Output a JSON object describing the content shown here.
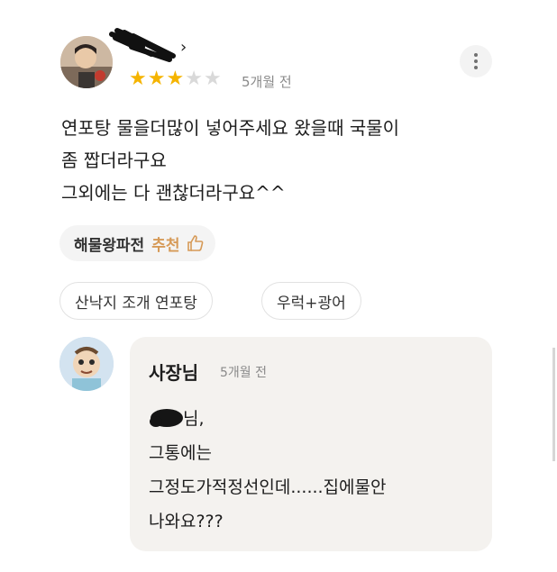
{
  "review": {
    "time_ago": "5개월 전",
    "rating": 3,
    "max_rating": 5,
    "text_lines": [
      "연포탕 물을더많이 넣어주세요 왔을때 국물이",
      "좀 짭더라구요",
      "그외에는 다 괜찮더라구요^^"
    ],
    "chevron": "›",
    "menu": {
      "name": "해물왕파전",
      "recommend_label": "추천"
    },
    "tags": [
      "산낙지 조개 연포탕",
      "우럭+광어"
    ]
  },
  "owner_reply": {
    "name": "사장님",
    "time_ago": "5개월 전",
    "greeting_suffix": "님,",
    "lines": [
      "그통에는",
      "그정도가적정선인데......집에물안",
      "나와요???"
    ]
  },
  "colors": {
    "star": "#f5b400",
    "star_off": "#d9d9d9",
    "recommend": "#d69a57",
    "bubble": "#f4f2ef"
  },
  "icons": [
    "more-vertical-icon",
    "thumbs-up-icon",
    "chevron-right-icon"
  ]
}
